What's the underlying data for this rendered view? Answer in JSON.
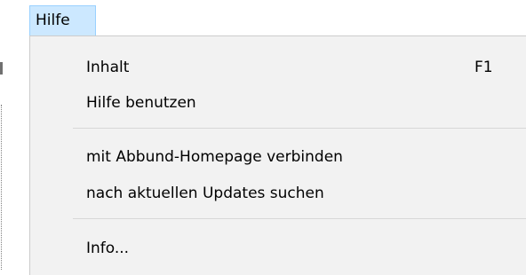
{
  "menubar": {
    "help_menu_label": "Hilfe"
  },
  "dropdown": {
    "items": [
      {
        "label": "Inhalt",
        "shortcut": "F1"
      },
      {
        "label": "Hilfe benutzen",
        "shortcut": ""
      },
      {
        "label": "mit Abbund-Homepage verbinden",
        "shortcut": ""
      },
      {
        "label": "nach aktuellen Updates suchen",
        "shortcut": ""
      },
      {
        "label": "Info...",
        "shortcut": ""
      }
    ]
  },
  "colors": {
    "menubar_selected_bg": "#cce8ff",
    "menubar_selected_border": "#99d1ff",
    "dropdown_bg": "#f2f2f2",
    "separator": "#d7d7d7"
  }
}
